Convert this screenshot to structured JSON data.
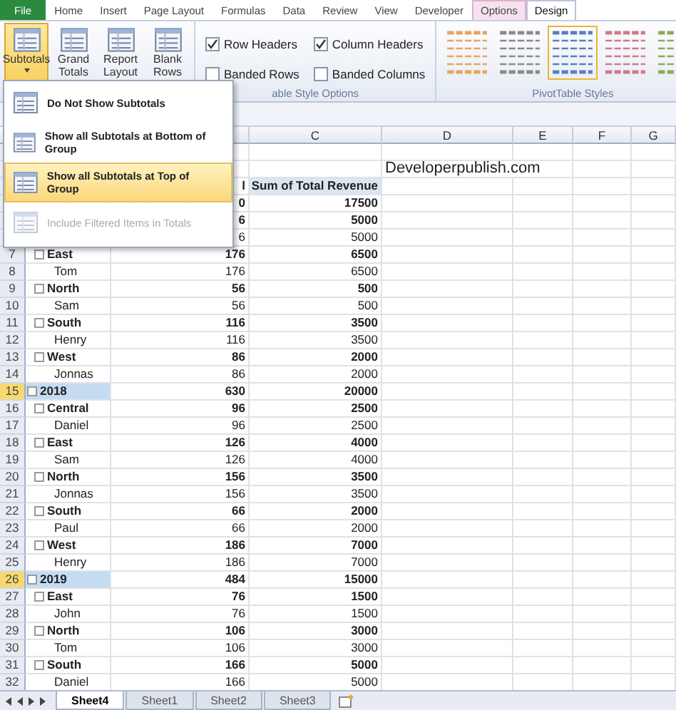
{
  "ribbon_tabs": [
    {
      "label": "File",
      "kind": "file",
      "selected": false
    },
    {
      "label": "Home",
      "kind": "normal",
      "selected": false
    },
    {
      "label": "Insert",
      "kind": "normal",
      "selected": false
    },
    {
      "label": "Page Layout",
      "kind": "normal",
      "selected": false
    },
    {
      "label": "Formulas",
      "kind": "normal",
      "selected": false
    },
    {
      "label": "Data",
      "kind": "normal",
      "selected": false
    },
    {
      "label": "Review",
      "kind": "normal",
      "selected": false
    },
    {
      "label": "View",
      "kind": "normal",
      "selected": false
    },
    {
      "label": "Developer",
      "kind": "normal",
      "selected": false
    },
    {
      "label": "Options",
      "kind": "contextual",
      "selected": false
    },
    {
      "label": "Design",
      "kind": "contextual",
      "selected": true
    }
  ],
  "layout_buttons": [
    {
      "label": "Subtotals",
      "selected": true
    },
    {
      "label": "Grand Totals",
      "selected": false
    },
    {
      "label": "Report Layout",
      "selected": false
    },
    {
      "label": "Blank Rows",
      "selected": false
    }
  ],
  "style_options": {
    "checkboxes": [
      {
        "label": "Row Headers",
        "checked": true
      },
      {
        "label": "Column Headers",
        "checked": true
      },
      {
        "label": "Banded Rows",
        "checked": false
      },
      {
        "label": "Banded Columns",
        "checked": false
      }
    ],
    "group_label": "able Style Options"
  },
  "styles": {
    "swatches": [
      {
        "color": "#e8a460",
        "selected": false
      },
      {
        "color": "#8a8a8a",
        "selected": false
      },
      {
        "color": "#5b7fbf",
        "selected": true
      },
      {
        "color": "#d07a8a",
        "selected": false
      },
      {
        "color": "#8aaa5a",
        "selected": false
      }
    ],
    "group_label": "PivotTable Styles"
  },
  "subtotals_menu": [
    {
      "label": "Do Not Show Subtotals",
      "selected": false,
      "disabled": false
    },
    {
      "label": "Show all Subtotals at Bottom of Group",
      "selected": false,
      "disabled": false
    },
    {
      "label": "Show all Subtotals at Top of Group",
      "selected": true,
      "disabled": false
    },
    {
      "label": "Include Filtered Items in Totals",
      "selected": false,
      "disabled": true
    }
  ],
  "columns": [
    "C",
    "D",
    "E",
    "F",
    "G"
  ],
  "rows": [
    {
      "kind": "blank"
    },
    {
      "kind": "note",
      "note": "Developerpublish.com"
    },
    {
      "kind": "header",
      "count": "l",
      "revenue": "Sum of Total Revenue"
    },
    {
      "kind": "year",
      "count": "0",
      "revenue": "17500",
      "selected": false
    },
    {
      "kind": "region",
      "count": "6",
      "revenue": "5000"
    },
    {
      "kind": "person",
      "count": "6",
      "revenue": "5000"
    },
    {
      "kind": "region",
      "number": "7",
      "label": "East",
      "count": "176",
      "revenue": "6500"
    },
    {
      "kind": "person",
      "number": "8",
      "label": "Tom",
      "count": "176",
      "revenue": "6500"
    },
    {
      "kind": "region",
      "number": "9",
      "label": "North",
      "count": "56",
      "revenue": "500"
    },
    {
      "kind": "person",
      "number": "10",
      "label": "Sam",
      "count": "56",
      "revenue": "500"
    },
    {
      "kind": "region",
      "number": "11",
      "label": "South",
      "count": "116",
      "revenue": "3500"
    },
    {
      "kind": "person",
      "number": "12",
      "label": "Henry",
      "count": "116",
      "revenue": "3500"
    },
    {
      "kind": "region",
      "number": "13",
      "label": "West",
      "count": "86",
      "revenue": "2000"
    },
    {
      "kind": "person",
      "number": "14",
      "label": "Jonnas",
      "count": "86",
      "revenue": "2000"
    },
    {
      "kind": "year",
      "number": "15",
      "label": "2018",
      "count": "630",
      "revenue": "20000",
      "selected": true
    },
    {
      "kind": "region",
      "number": "16",
      "label": "Central",
      "count": "96",
      "revenue": "2500"
    },
    {
      "kind": "person",
      "number": "17",
      "label": "Daniel",
      "count": "96",
      "revenue": "2500"
    },
    {
      "kind": "region",
      "number": "18",
      "label": "East",
      "count": "126",
      "revenue": "4000"
    },
    {
      "kind": "person",
      "number": "19",
      "label": "Sam",
      "count": "126",
      "revenue": "4000"
    },
    {
      "kind": "region",
      "number": "20",
      "label": "North",
      "count": "156",
      "revenue": "3500"
    },
    {
      "kind": "person",
      "number": "21",
      "label": "Jonnas",
      "count": "156",
      "revenue": "3500"
    },
    {
      "kind": "region",
      "number": "22",
      "label": "South",
      "count": "66",
      "revenue": "2000"
    },
    {
      "kind": "person",
      "number": "23",
      "label": "Paul",
      "count": "66",
      "revenue": "2000"
    },
    {
      "kind": "region",
      "number": "24",
      "label": "West",
      "count": "186",
      "revenue": "7000"
    },
    {
      "kind": "person",
      "number": "25",
      "label": "Henry",
      "count": "186",
      "revenue": "7000"
    },
    {
      "kind": "year",
      "number": "26",
      "label": "2019",
      "count": "484",
      "revenue": "15000",
      "selected": true
    },
    {
      "kind": "region",
      "number": "27",
      "label": "East",
      "count": "76",
      "revenue": "1500"
    },
    {
      "kind": "person",
      "number": "28",
      "label": "John",
      "count": "76",
      "revenue": "1500"
    },
    {
      "kind": "region",
      "number": "29",
      "label": "North",
      "count": "106",
      "revenue": "3000"
    },
    {
      "kind": "person",
      "number": "30",
      "label": "Tom",
      "count": "106",
      "revenue": "3000"
    },
    {
      "kind": "region",
      "number": "31",
      "label": "South",
      "count": "166",
      "revenue": "5000"
    },
    {
      "kind": "person",
      "number": "32",
      "label": "Daniel",
      "count": "166",
      "revenue": "5000"
    }
  ],
  "sheet_tabs": [
    {
      "label": "Sheet4",
      "selected": true
    },
    {
      "label": "Sheet1",
      "selected": false
    },
    {
      "label": "Sheet2",
      "selected": false
    },
    {
      "label": "Sheet3",
      "selected": false
    }
  ]
}
